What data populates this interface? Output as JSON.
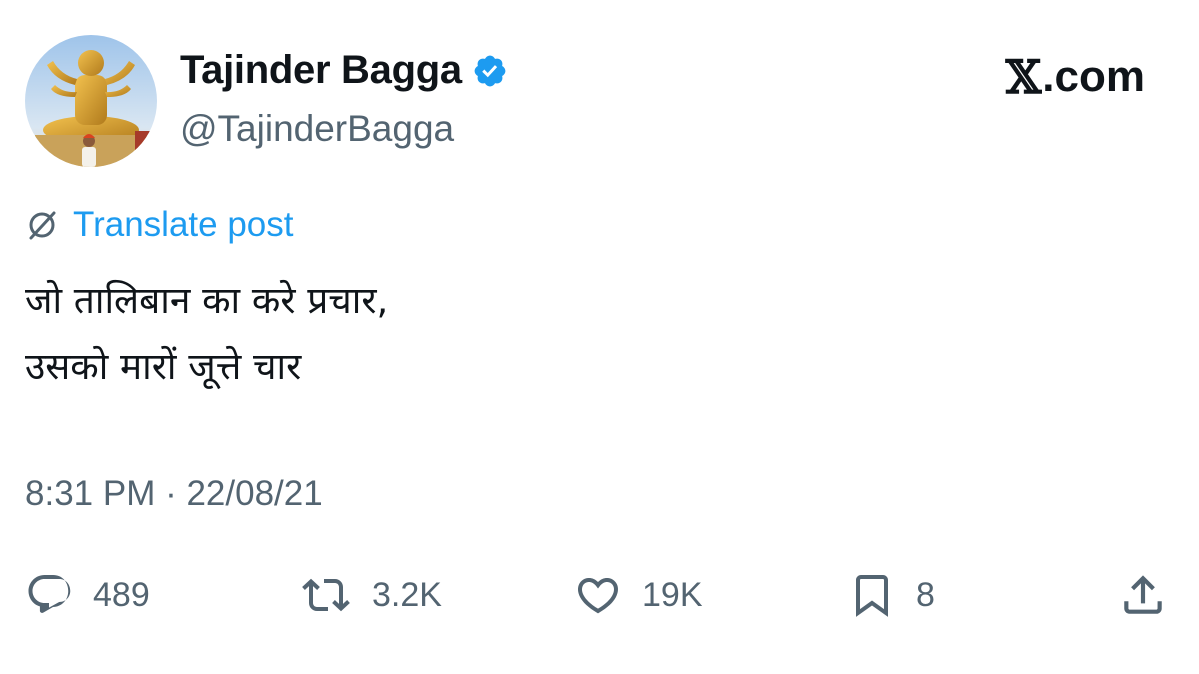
{
  "author": {
    "display_name": "Tajinder Bagga",
    "handle": "@TajinderBagga",
    "avatar_icon": "avatar-photo-statue",
    "verified_icon": "verified-badge-icon",
    "verified_color": "#1d9bf0"
  },
  "brand": {
    "logo_glyph": "𝕏",
    "domain_suffix": ".com"
  },
  "translate": {
    "icon": "globe-icon",
    "label": "Translate post",
    "color": "#1d9bf0"
  },
  "tweet": {
    "lines": [
      "जो तालिबान का करे प्रचार,",
      "उसको मारों जूत्ते चार"
    ]
  },
  "timestamp": "8:31 PM · 22/08/21",
  "actions": {
    "reply": {
      "icon": "reply-icon",
      "count": "489"
    },
    "repost": {
      "icon": "repost-icon",
      "count": "3.2K"
    },
    "like": {
      "icon": "heart-icon",
      "count": "19K"
    },
    "bookmark": {
      "icon": "bookmark-icon",
      "count": "8"
    },
    "share": {
      "icon": "share-icon"
    }
  },
  "colors": {
    "text": "#0f1419",
    "secondary": "#536471",
    "accent": "#1d9bf0"
  }
}
